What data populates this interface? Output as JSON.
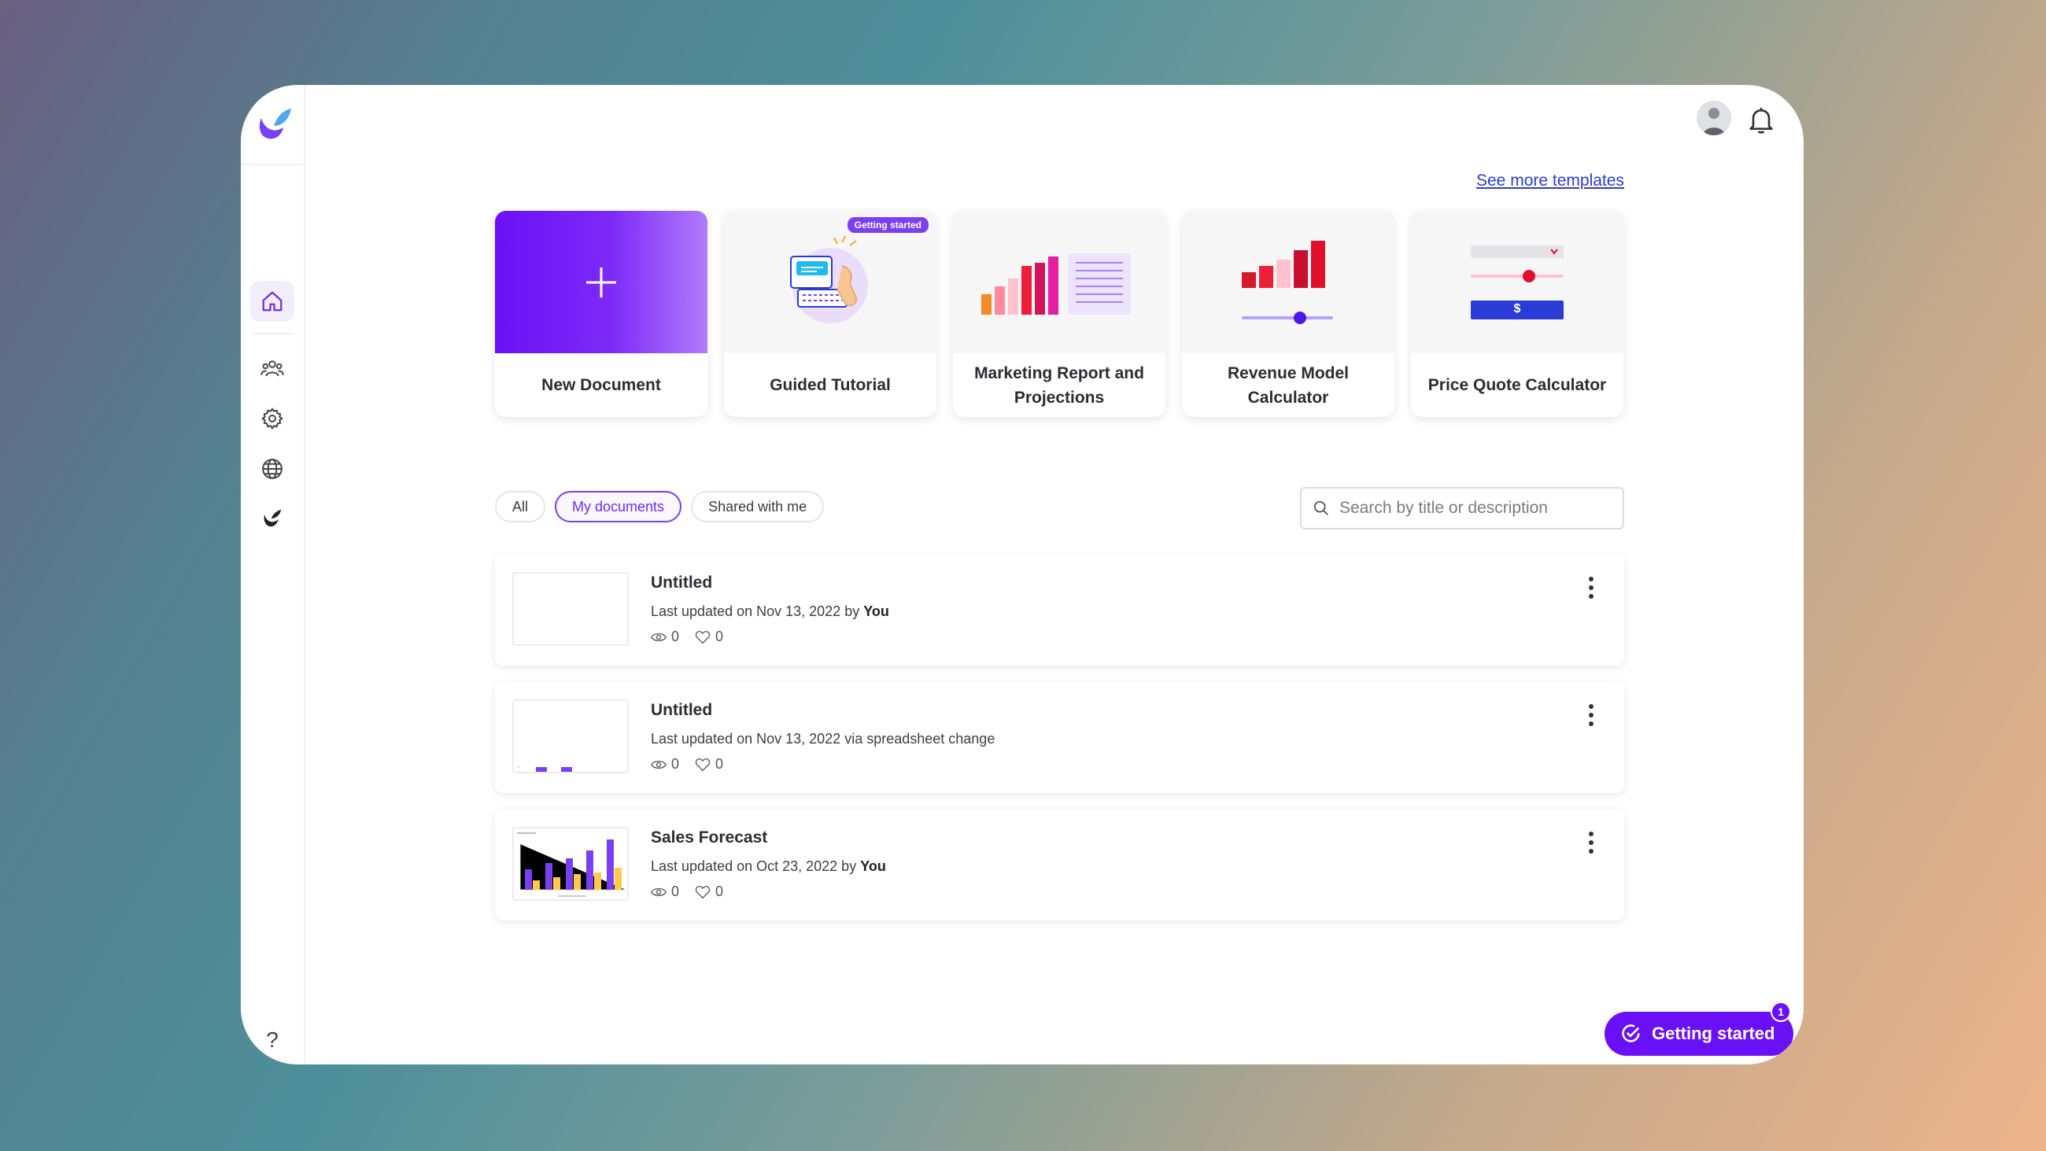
{
  "header": {
    "see_more_label": "See more templates",
    "avatar_icon": "user-avatar",
    "bell_icon": "bell-icon"
  },
  "sidebar": {
    "items": [
      {
        "name": "home",
        "icon": "home-icon",
        "active": true
      },
      {
        "name": "team",
        "icon": "users-icon"
      },
      {
        "name": "settings",
        "icon": "gear-icon"
      },
      {
        "name": "globe",
        "icon": "globe-icon"
      },
      {
        "name": "brand",
        "icon": "bird-icon"
      }
    ],
    "help_label": "?"
  },
  "templates": [
    {
      "label": "New Document"
    },
    {
      "label": "Guided Tutorial",
      "badge": "Getting started"
    },
    {
      "label": "Marketing Report and Projections"
    },
    {
      "label": "Revenue Model Calculator"
    },
    {
      "label": "Price Quote Calculator"
    }
  ],
  "price_quote_symbol": "$",
  "filters": {
    "all": "All",
    "mine": "My documents",
    "shared": "Shared with me",
    "active": "My documents"
  },
  "search": {
    "placeholder": "Search by title or description",
    "value": ""
  },
  "documents": [
    {
      "title": "Untitled",
      "meta_prefix": "Last updated on Nov 13, 2022 by ",
      "meta_author": "You",
      "views": "0",
      "likes": "0"
    },
    {
      "title": "Untitled",
      "meta_prefix": "Last updated on Nov 13, 2022 via spreadsheet change",
      "meta_author": "",
      "views": "0",
      "likes": "0"
    },
    {
      "title": "Sales Forecast",
      "meta_prefix": "Last updated on Oct 23, 2022 by ",
      "meta_author": "You",
      "views": "0",
      "likes": "0"
    }
  ],
  "getting_started": {
    "label": "Getting started",
    "count": "1"
  },
  "colors": {
    "accent": "#6a10f6",
    "accent_light": "#b07cf9",
    "link": "#2b3bd6"
  }
}
